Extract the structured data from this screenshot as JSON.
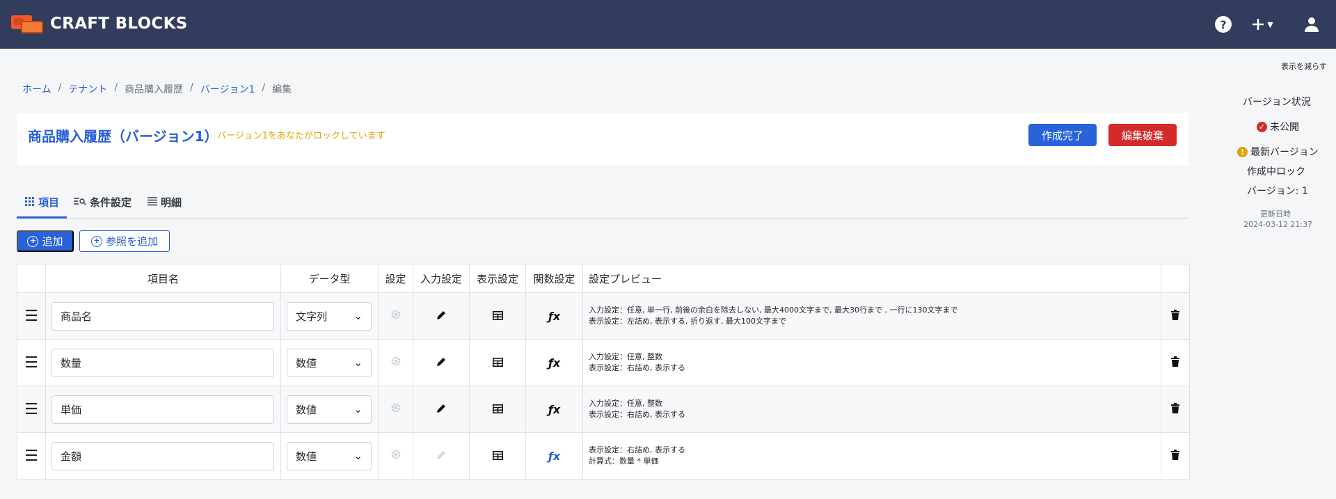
{
  "header": {
    "logo_text": "CRAFT BLOCKS",
    "help_icon": "question-circle-icon",
    "plus_icon": "plus-icon",
    "user_icon": "user-icon"
  },
  "breadcrumb": {
    "home": "ホーム",
    "tenant": "テナント",
    "table": "商品購入履歴",
    "version": "バージョン1",
    "current": "編集"
  },
  "title": {
    "heading": "商品購入履歴（バージョン1）",
    "lock_message": "バージョン1をあなたがロックしています",
    "complete_label": "作成完了",
    "discard_label": "編集破棄"
  },
  "tabs": [
    {
      "label": "項目"
    },
    {
      "label": "条件設定"
    },
    {
      "label": "明細"
    }
  ],
  "actions": {
    "add_label": "追加",
    "add_ref_label": "参照を追加"
  },
  "table": {
    "headers": {
      "name": "項目名",
      "type": "データ型",
      "settings": "設定",
      "input": "入力設定",
      "display": "表示設定",
      "function": "関数設定",
      "preview": "設定プレビュー"
    },
    "rows": [
      {
        "name": "商品名",
        "type": "文字列",
        "preview1": "入力設定：任意, 単一行, 前後の余白を除去しない, 最大4000文字まで, 最大30行まで , 一行に130文字まで",
        "preview2": "表示設定：左詰め, 表示する, 折り返す, 最大100文字まで"
      },
      {
        "name": "数量",
        "type": "数値",
        "preview1": "入力設定：任意, 整数",
        "preview2": "表示設定：右詰め, 表示する"
      },
      {
        "name": "単価",
        "type": "数値",
        "preview1": "入力設定：任意, 整数",
        "preview2": "表示設定：右詰め, 表示する"
      },
      {
        "name": "金額",
        "type": "数値",
        "preview1": "表示設定：右詰め, 表示する",
        "preview2": "計算式：数量 * 単価"
      }
    ]
  },
  "side": {
    "reduce_label": "表示を減らす",
    "title": "バージョン状況",
    "status_unpublished": "未公開",
    "status_latest": "最新バージョン",
    "status_locked": "作成中ロック",
    "version_label": "バージョン: 1",
    "updated_label": "更新日時",
    "updated_value": "2024-03-12 21:37"
  },
  "colors": {
    "header_bg": "#323c5c",
    "primary": "#2962d9",
    "danger": "#d42a2a",
    "warning": "#e0a300"
  }
}
